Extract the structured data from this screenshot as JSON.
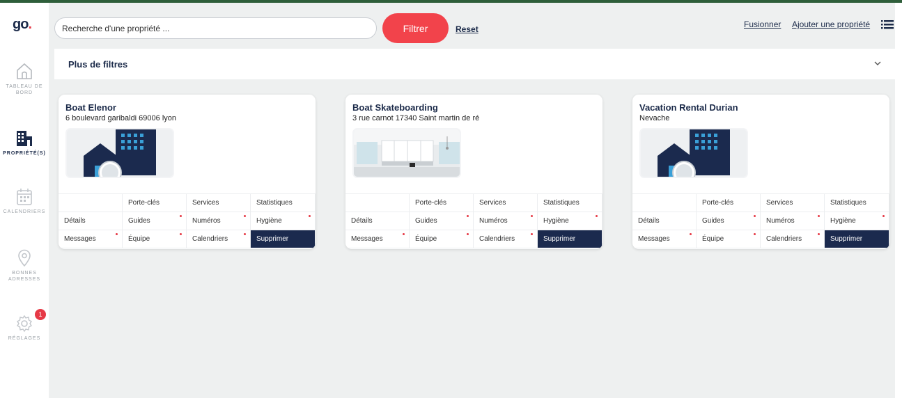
{
  "sidebar": {
    "logo": {
      "text": "go",
      "dot": "."
    },
    "items": [
      {
        "label": "TABLEAU DE BORD",
        "icon": "home-icon"
      },
      {
        "label": "PROPRIÉTÉ(S)",
        "icon": "building-icon"
      },
      {
        "label": "CALENDRIERS",
        "icon": "calendar-icon"
      },
      {
        "label": "BONNES ADRESSES",
        "icon": "location-pin-icon"
      },
      {
        "label": "RÉGLAGES",
        "icon": "gear-icon",
        "badge": "1"
      }
    ]
  },
  "toolbar": {
    "search_placeholder": "Recherche d'une propriété ...",
    "filter_label": "Filtrer",
    "reset_label": "Reset",
    "merge_label": "Fusionner",
    "add_label": "Ajouter une propriété"
  },
  "filters": {
    "title": "Plus de filtres"
  },
  "card_actions": {
    "header": [
      "Porte-clés",
      "Services",
      "Statistiques"
    ],
    "row1": [
      "Détails",
      "Guides",
      "Numéros",
      "Hygiène"
    ],
    "row2": [
      "Messages",
      "Équipe",
      "Calendriers",
      "Supprimer"
    ]
  },
  "properties": [
    {
      "name": "Boat Elenor",
      "address": "6 boulevard garibaldi 69006 lyon",
      "image": "placeholder-building"
    },
    {
      "name": "Boat Skateboarding",
      "address": "3 rue carnot 17340 Saint martin de ré",
      "image": "kitchen-photo"
    },
    {
      "name": "Vacation Rental Durian",
      "address": "Nevache",
      "image": "placeholder-building"
    }
  ],
  "colors": {
    "accent": "#f2434b",
    "navy": "#1b2a4e",
    "topbar": "#2e5e3a",
    "background": "#eef0f0"
  }
}
